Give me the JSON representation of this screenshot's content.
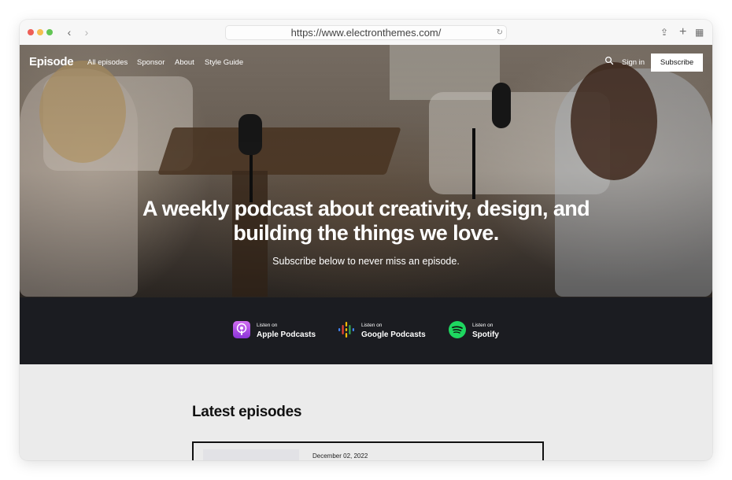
{
  "browser": {
    "url": "https://www.electronthemes.com/",
    "back_glyph": "‹",
    "forward_glyph": "›",
    "reload_glyph": "↻",
    "share_glyph": "⇪",
    "newtab_glyph": "+",
    "tabs_glyph": "▦"
  },
  "site": {
    "logo": "Episode",
    "nav": [
      "All episodes",
      "Sponsor",
      "About",
      "Style Guide"
    ],
    "sign_in": "Sign in",
    "subscribe": "Subscribe"
  },
  "hero": {
    "title_line1": "A weekly podcast about creativity, design, and",
    "title_line2": "building the things we love.",
    "subtitle": "Subscribe below to never miss an episode."
  },
  "platforms": [
    {
      "small": "Listen on",
      "name": "Apple Podcasts",
      "icon": "apple-podcasts-icon",
      "color": "#a64be6"
    },
    {
      "small": "Listen on",
      "name": "Google Podcasts",
      "icon": "google-podcasts-icon",
      "color": "#fbbc04"
    },
    {
      "small": "Listen on",
      "name": "Spotify",
      "icon": "spotify-icon",
      "color": "#1ed760"
    }
  ],
  "latest": {
    "title": "Latest episodes",
    "episodes": [
      {
        "date": "December 02, 2022"
      }
    ]
  },
  "colors": {
    "band": "#1b1c21",
    "page_bg": "#ebebeb",
    "accent": "#ffffff"
  }
}
